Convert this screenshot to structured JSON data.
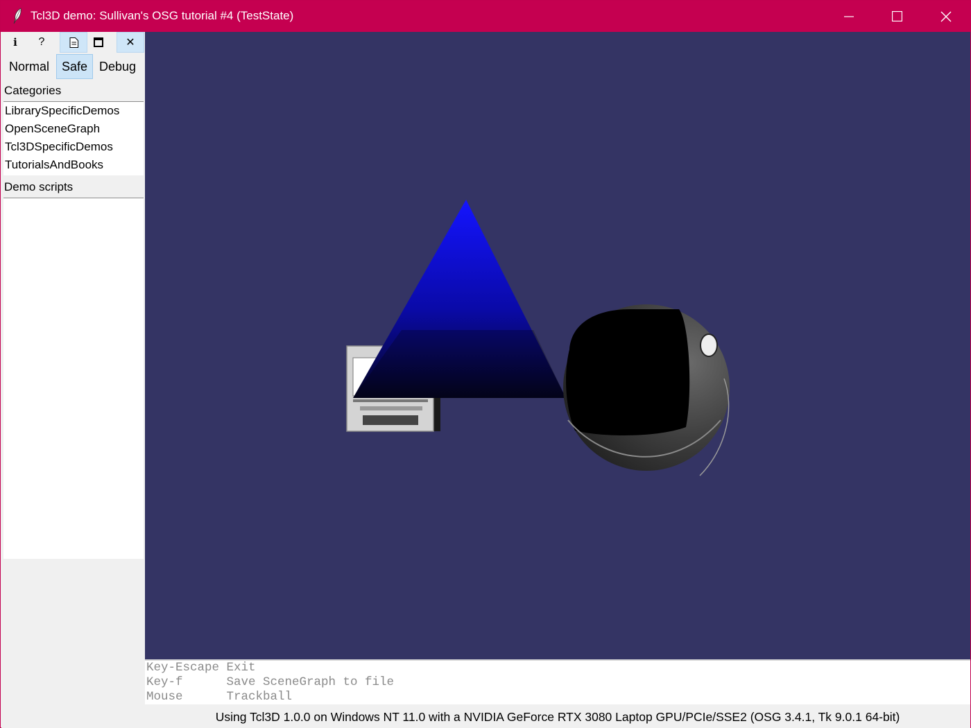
{
  "window": {
    "title": "Tcl3D demo: Sullivan's OSG tutorial #4 (TestState)",
    "icon": "feather-icon",
    "controls": [
      "minimize-icon",
      "maximize-icon",
      "close-icon"
    ],
    "title_bar_color": "#c50050"
  },
  "toolbar": {
    "buttons": [
      {
        "icon": "info-icon",
        "glyph": "i"
      },
      {
        "icon": "help-icon",
        "glyph": "?"
      },
      {
        "icon": "document-icon",
        "glyph": ""
      },
      {
        "icon": "window-icon",
        "glyph": ""
      },
      {
        "icon": "close-icon",
        "glyph": "✕"
      }
    ]
  },
  "modes": {
    "items": [
      "Normal",
      "Safe",
      "Debug"
    ],
    "selected": "Safe"
  },
  "categories": {
    "label": "Categories",
    "items": [
      "LibrarySpecificDemos",
      "OpenSceneGraph",
      "Tcl3DSpecificDemos",
      "TutorialsAndBooks"
    ]
  },
  "demo_scripts": {
    "label": "Demo scripts",
    "items": []
  },
  "scene": {
    "background_color": "#343464"
  },
  "console": {
    "lines": [
      "Key-Escape Exit",
      "Key-f      Save SceneGraph to file",
      "Mouse      Trackball"
    ]
  },
  "status": {
    "text": "Using Tcl3D 1.0.0 on Windows NT 11.0 with a NVIDIA GeForce RTX 3080 Laptop GPU/PCIe/SSE2 (OSG 3.4.1, Tk 9.0.1 64-bit)"
  }
}
